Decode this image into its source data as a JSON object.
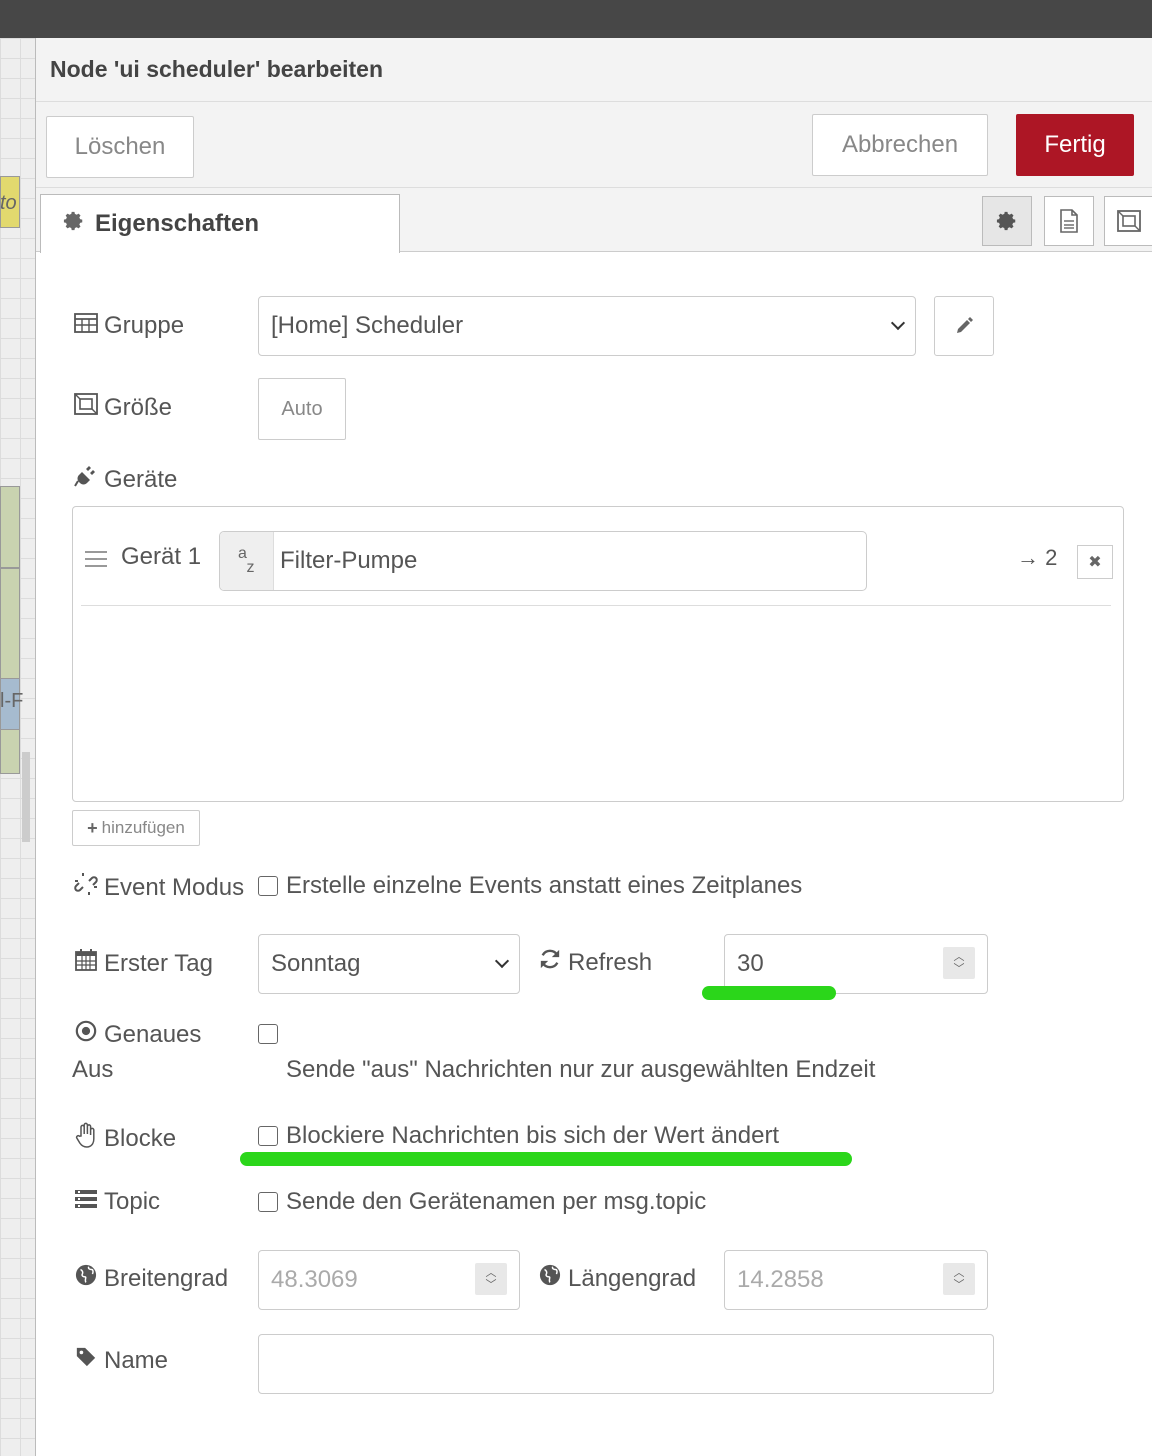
{
  "workspace": {
    "node_text_1": "to",
    "node_text_2": "l-F"
  },
  "panel": {
    "title": "Node 'ui scheduler' bearbeiten"
  },
  "buttons": {
    "delete": "Löschen",
    "cancel": "Abbrechen",
    "done": "Fertig"
  },
  "tabs": {
    "properties": "Eigenschaften"
  },
  "form": {
    "group": {
      "label": "Gruppe",
      "value": "[Home] Scheduler"
    },
    "size": {
      "label": "Größe",
      "value": "Auto"
    },
    "devices": {
      "label": "Geräte",
      "items": [
        {
          "label": "Gerät 1",
          "type_glyph_top": "a",
          "type_glyph_bottom": "z",
          "value": "Filter-Pumpe",
          "output": "→ 2"
        }
      ],
      "add_label": "hinzufügen"
    },
    "event_mode": {
      "label": "Event Modus",
      "text": "Erstelle einzelne Events anstatt eines Zeitplanes",
      "checked": false
    },
    "first_day": {
      "label": "Erster Tag",
      "value": "Sonntag"
    },
    "refresh": {
      "label": "Refresh",
      "value": "30"
    },
    "exact_off": {
      "label_line1": "Genaues",
      "label_line2": "Aus",
      "text": "Sende \"aus\" Nachrichten nur zur ausgewählten Endzeit",
      "checked": false
    },
    "block": {
      "label": "Blocke",
      "text": "Blockiere Nachrichten bis sich der Wert ändert",
      "checked": false
    },
    "topic": {
      "label": "Topic",
      "text": "Sende den Gerätenamen per msg.topic",
      "checked": false
    },
    "latitude": {
      "label": "Breitengrad",
      "placeholder": "48.3069"
    },
    "longitude": {
      "label": "Längengrad",
      "placeholder": "14.2858"
    },
    "name": {
      "label": "Name",
      "value": ""
    }
  },
  "colors": {
    "accent": "#ad1625",
    "highlight": "#2bd61a"
  }
}
